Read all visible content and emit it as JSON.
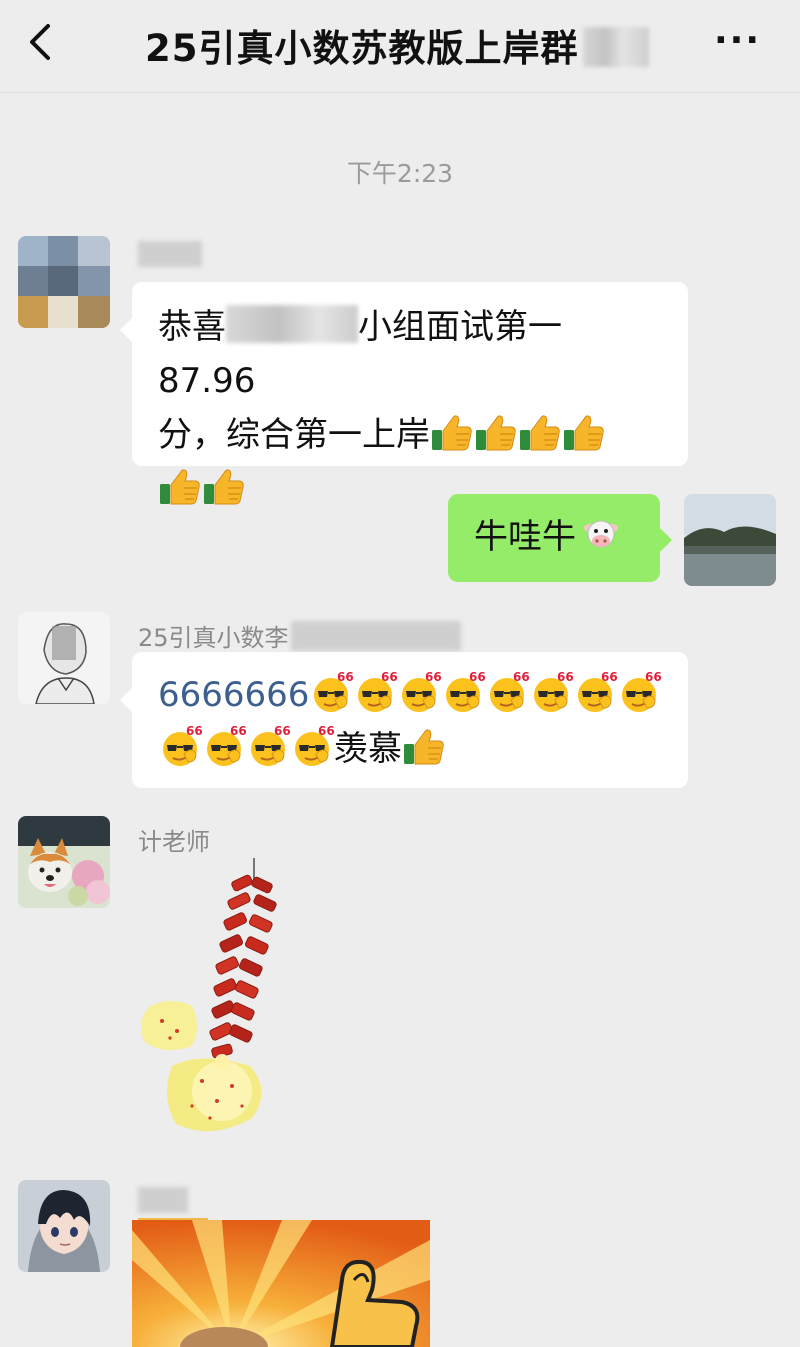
{
  "header": {
    "back_icon": "chevron-left-icon",
    "title": "25引真小数苏教版上岸群",
    "more_label": "···"
  },
  "timestamp": "下午2:23",
  "messages": [
    {
      "side": "left",
      "sender": "",
      "text_a": "恭喜",
      "text_b": "小组面试第一 87.96",
      "text_c": "分，综合第一上岸",
      "emoji": "thumbs-up"
    },
    {
      "side": "right",
      "text": "牛哇牛",
      "emoji": "cow-face"
    },
    {
      "side": "left",
      "sender": "25引真小数李",
      "text": "6666666",
      "text_tail": "羡慕",
      "emoji": "666-face",
      "emoji_label": "666"
    },
    {
      "side": "left",
      "sender": "计老师",
      "sticker": "firecrackers"
    },
    {
      "side": "left",
      "sender": "",
      "image": "thumbs-up-sticker-image"
    }
  ],
  "colors": {
    "background": "#ededed",
    "bubble_in": "#ffffff",
    "bubble_out": "#95ec69",
    "timestamp": "#9b9b9b",
    "sender_name": "#8a8a8a"
  }
}
